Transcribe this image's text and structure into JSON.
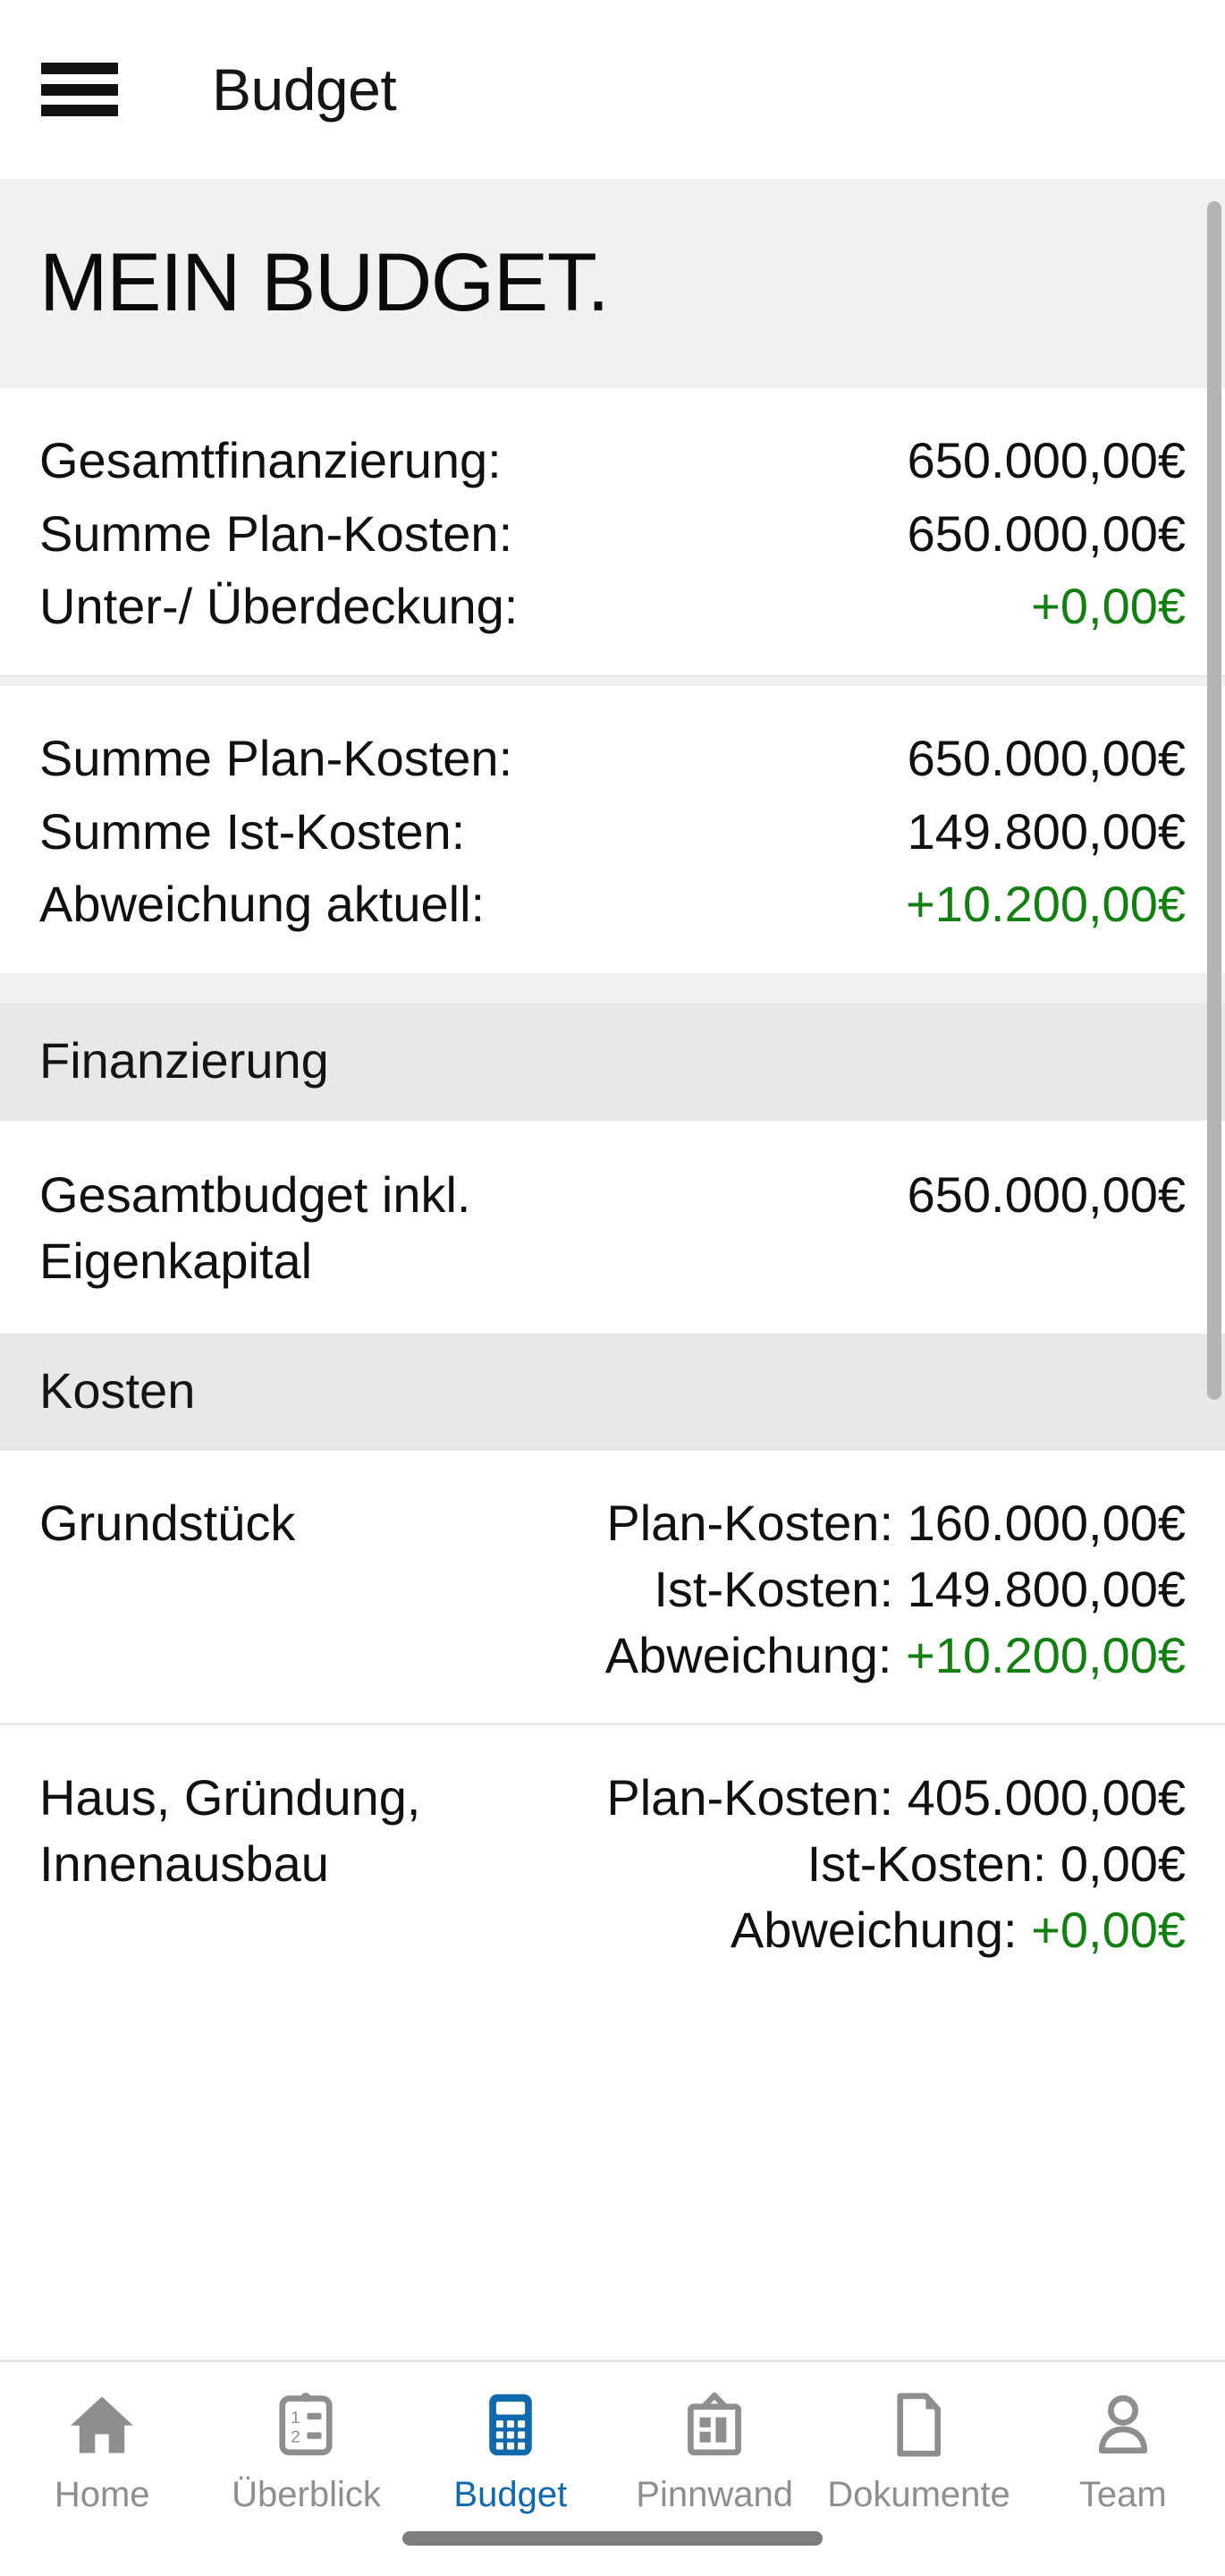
{
  "appbar": {
    "menu_icon": "hamburger-menu-icon",
    "title": "Budget"
  },
  "hero": {
    "title": "MEIN BUDGET."
  },
  "summary_blocks": [
    {
      "rows": [
        {
          "label": "Gesamtfinanzierung:",
          "value": "650.000,00€",
          "positive": false
        },
        {
          "label": "Summe Plan-Kosten:",
          "value": "650.000,00€",
          "positive": false
        },
        {
          "label": "Unter-/ Überdeckung:",
          "value": "+0,00€",
          "positive": true
        }
      ]
    },
    {
      "rows": [
        {
          "label": "Summe Plan-Kosten:",
          "value": "650.000,00€",
          "positive": false
        },
        {
          "label": "Summe Ist-Kosten:",
          "value": "149.800,00€",
          "positive": false
        },
        {
          "label": "Abweichung aktuell:",
          "value": "+10.200,00€",
          "positive": true
        }
      ]
    }
  ],
  "sections": [
    {
      "header": "Finanzierung",
      "finance_row": {
        "name": "Gesamtbudget inkl. Eigenkapital",
        "amount": "650.000,00€"
      }
    },
    {
      "header": "Kosten",
      "items": [
        {
          "name": "Grundstück",
          "plan_label": "Plan-Kosten:",
          "plan_value": "160.000,00€",
          "ist_label": "Ist-Kosten:",
          "ist_value": "149.800,00€",
          "abw_label": "Abweichung:",
          "abw_value": "+10.200,00€"
        },
        {
          "name": "Haus, Gründung, Innenausbau",
          "plan_label": "Plan-Kosten:",
          "plan_value": "405.000,00€",
          "ist_label": "Ist-Kosten:",
          "ist_value": "0,00€",
          "abw_label": "Abweichung:",
          "abw_value": "+0,00€"
        }
      ]
    }
  ],
  "tabbar": {
    "items": [
      {
        "label": "Home",
        "icon": "home-icon",
        "active": false
      },
      {
        "label": "Überblick",
        "icon": "clipboard-list-icon",
        "active": false
      },
      {
        "label": "Budget",
        "icon": "calculator-icon",
        "active": true
      },
      {
        "label": "Pinnwand",
        "icon": "bulletin-board-icon",
        "active": false
      },
      {
        "label": "Dokumente",
        "icon": "document-page-icon",
        "active": false
      },
      {
        "label": "Team",
        "icon": "person-icon",
        "active": false
      }
    ]
  },
  "colors": {
    "accent": "#1069ad",
    "positive": "#118011",
    "inactive_tab": "#8e8e8e",
    "hero_background": "#f1f1f1",
    "section_header_background": "#e8e8e8"
  }
}
